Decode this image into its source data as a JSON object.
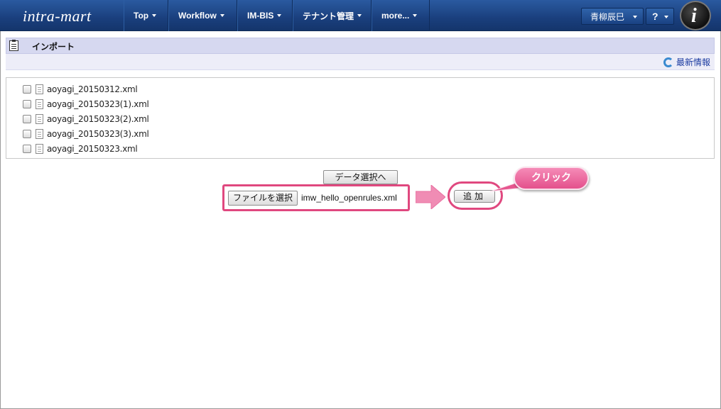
{
  "header": {
    "logo_text": "intra-mart",
    "nav": [
      {
        "label": "Top"
      },
      {
        "label": "Workflow"
      },
      {
        "label": "IM-BIS"
      },
      {
        "label": "テナント管理"
      },
      {
        "label": "more..."
      }
    ],
    "user_name": "青柳辰巳",
    "help_label": "?",
    "brand_letter": "i"
  },
  "page": {
    "title": "インポート",
    "refresh_label": "最新情報"
  },
  "files": [
    {
      "name": "aoyagi_20150312.xml",
      "checked": false
    },
    {
      "name": "aoyagi_20150323(1).xml",
      "checked": false
    },
    {
      "name": "aoyagi_20150323(2).xml",
      "checked": false
    },
    {
      "name": "aoyagi_20150323(3).xml",
      "checked": false
    },
    {
      "name": "aoyagi_20150323.xml",
      "checked": false
    }
  ],
  "controls": {
    "data_select_label": "データ選択へ",
    "choose_file_label": "ファイルを選択",
    "chosen_file": "imw_hello_openrules.xml",
    "add_label": "追加"
  },
  "annotation": {
    "callout_text": "クリック",
    "highlight_color": "#e0487f"
  },
  "colors": {
    "nav_bg": "#1a3f7d",
    "title_bar": "#d6d8f0",
    "link": "#1a3aa0"
  }
}
